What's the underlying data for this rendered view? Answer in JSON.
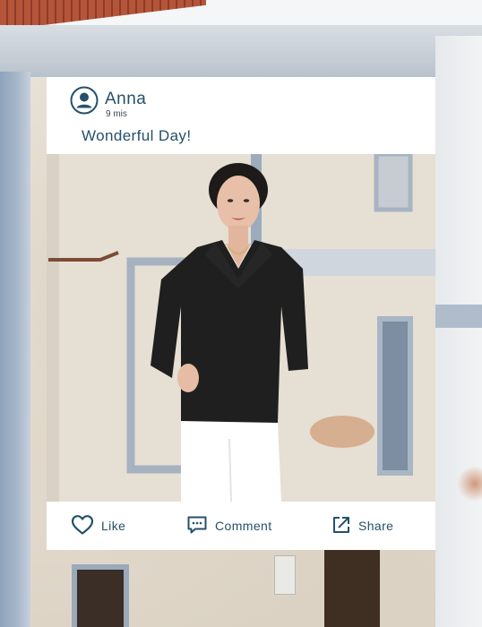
{
  "post": {
    "author": "Anna",
    "time": "9 mis",
    "caption": "Wonderful Day!"
  },
  "actions": {
    "like": "Like",
    "comment": "Comment",
    "share": "Share"
  },
  "icons": {
    "avatar": "user-avatar-icon",
    "like": "heart-icon",
    "comment": "comment-bubble-icon",
    "share": "share-arrow-icon"
  },
  "colors": {
    "accent": "#25506b",
    "card": "#ffffff",
    "sweater": "#1f1f1f",
    "pants": "#ffffff"
  }
}
